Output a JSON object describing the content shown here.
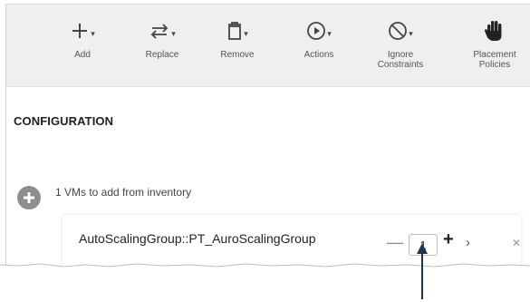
{
  "toolbar": {
    "add": "Add",
    "replace": "Replace",
    "remove": "Remove",
    "actions": "Actions",
    "ignore_constraints": "Ignore\nConstraints",
    "placement_policies": "Placement\nPolicies"
  },
  "section_title": "CONFIGURATION",
  "add_summary": "1 VMs to add from inventory",
  "group": {
    "name": "AutoScalingGroup::PT_AuroScalingGroup",
    "quantity": "1"
  },
  "icons": {
    "add": "plus-icon",
    "replace": "swap-arrows-icon",
    "remove": "trash-icon",
    "actions": "play-circle-icon",
    "ignore_constraints": "prohibit-icon",
    "placement_policies": "hand-icon",
    "add_circle": "plus-circle-icon",
    "decrement": "minus-icon",
    "increment": "plus-icon",
    "expand": "chevron-right-icon",
    "remove_item": "close-icon",
    "annotation": "arrow-up-icon"
  },
  "colors": {
    "toolbar_bg": "#efefef",
    "add_circle": "#8e8e8e"
  }
}
